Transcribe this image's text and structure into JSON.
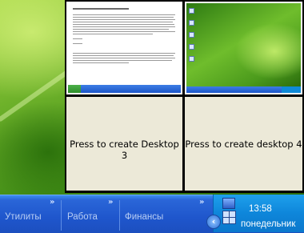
{
  "pager": {
    "desktop3_label": "Press to create Desktop 3",
    "desktop4_label": "Press to create desktop 4"
  },
  "taskbar": {
    "toolbars": [
      {
        "label": "Утилиты",
        "chevron": "»"
      },
      {
        "label": "Работа",
        "chevron": "»"
      },
      {
        "label": "Финансы",
        "chevron": "»"
      }
    ]
  },
  "tray": {
    "time": "13:58",
    "day": "понедельник",
    "collapse_glyph": "‹"
  },
  "colors": {
    "taskbar": "#1f56cc",
    "tray": "#0e86da",
    "pager_bg": "#ece9d8"
  },
  "icons": {
    "tray_icon_1": "network-monitor-icon",
    "tray_icon_2": "virtual-desktops-icon",
    "collapse": "chevron-left-icon"
  }
}
